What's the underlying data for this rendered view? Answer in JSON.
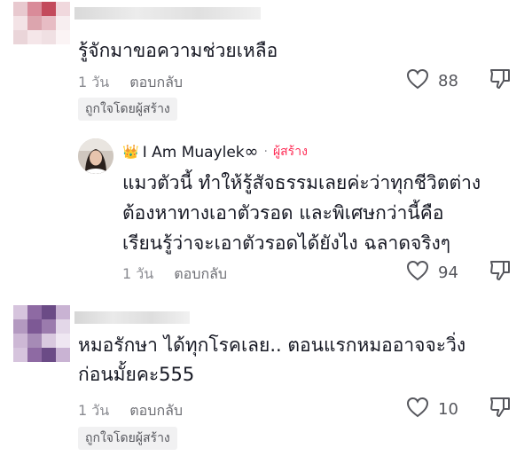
{
  "comments": [
    {
      "text_lines": [
        "รู้จักมาขอความช่วยเหลือ"
      ],
      "time": "1 วัน",
      "reply_label": "ตอบกลับ",
      "likes": "88",
      "creator_liked": "ถูกใจโดยผู้สร้าง",
      "avatar_colors": [
        "#e8c9cf",
        "#d98b99",
        "#c34a5c",
        "#f0d8dd",
        "#f3e3e6",
        "#dca5ae",
        "#e7bcc4",
        "#f7eef0",
        "#ead5d9",
        "#f5e6e9",
        "#f0e0e3",
        "#fbf4f5"
      ]
    },
    {
      "text_lines": [
        "หมอรักษา ได้ทุกโรคเลย.. ตอนแรกหมออาจจะวิ่ง",
        "ก่อนมั้ยคะ555"
      ],
      "time": "1 วัน",
      "reply_label": "ตอบกลับ",
      "likes": "10",
      "creator_liked": "ถูกใจโดยผู้สร้าง",
      "avatar_colors": [
        "#d6c4dd",
        "#8e6aa3",
        "#6b4b86",
        "#c9b3d3",
        "#b399c0",
        "#7d5995",
        "#9b7bad",
        "#e3d7e8",
        "#cdb8d5",
        "#a68bb6",
        "#d9c9df",
        "#efe7f2"
      ]
    }
  ],
  "creator_reply": {
    "name": "I Am Muaylek",
    "name_suffix": "∞",
    "separator": "·",
    "creator_label": "ผู้สร้าง",
    "text_lines": [
      "แมวตัวนี้ ทำให้รู้สัจธรรมเลยค่ะว่าทุกชีวิตต่าง",
      "ต้องหาทางเอาตัวรอด และพิเศษกว่านี้คือ",
      "เรียนรู้ว่าจะเอาตัวรอดได้ยังไง ฉลาดจริงๆ"
    ],
    "time": "1 วัน",
    "reply_label": "ตอบกลับ",
    "likes": "94",
    "crown": "👑"
  },
  "icons": {
    "heart": "heart-outline-icon",
    "dislike": "thumbs-down-icon"
  }
}
